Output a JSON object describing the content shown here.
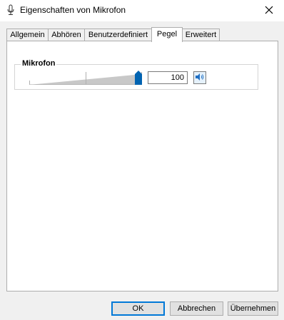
{
  "window": {
    "title": "Eigenschaften von Mikrofon"
  },
  "tabs": [
    {
      "label": "Allgemein",
      "active": false
    },
    {
      "label": "Abhören",
      "active": false
    },
    {
      "label": "Benutzerdefiniert",
      "active": false
    },
    {
      "label": "Pegel",
      "active": true
    },
    {
      "label": "Erweitert",
      "active": false
    }
  ],
  "levels": {
    "group_label": "Mikrofon",
    "level": 100,
    "level_text": "100",
    "level_fraction": 1.0
  },
  "buttons": {
    "ok": "OK",
    "cancel": "Abbrechen",
    "apply": "Übernehmen"
  },
  "icons": {
    "title": "microphone-icon",
    "close": "close-icon",
    "mute": "speaker-icon"
  },
  "colors": {
    "accent": "#0078d7",
    "thumb": "#0063b1"
  }
}
